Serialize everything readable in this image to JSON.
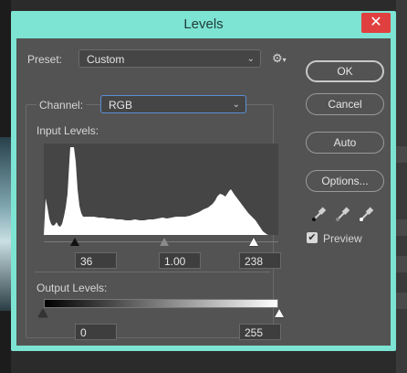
{
  "dialog": {
    "title": "Levels",
    "close_glyph": "✕"
  },
  "preset": {
    "label": "Preset:",
    "value": "Custom",
    "menu_icon": "gear-icon"
  },
  "channel": {
    "label": "Channel:",
    "value": "RGB"
  },
  "input_levels": {
    "label": "Input Levels:",
    "black": "36",
    "gamma": "1.00",
    "white": "238",
    "black_level": 36,
    "gamma_level": 1.0,
    "white_level": 238
  },
  "output_levels": {
    "label": "Output Levels:",
    "black": "0",
    "white": "255",
    "black_level": 0,
    "white_level": 255
  },
  "buttons": {
    "ok": "OK",
    "cancel": "Cancel",
    "auto": "Auto",
    "options": "Options..."
  },
  "eyedroppers": [
    "black-point-eyedropper-icon",
    "gray-point-eyedropper-icon",
    "white-point-eyedropper-icon"
  ],
  "preview": {
    "label": "Preview",
    "checked": true
  },
  "colors": {
    "title_bar": "#7de3d3",
    "panel": "#535353",
    "close": "#e0403f",
    "focus": "#5a8fd8"
  }
}
